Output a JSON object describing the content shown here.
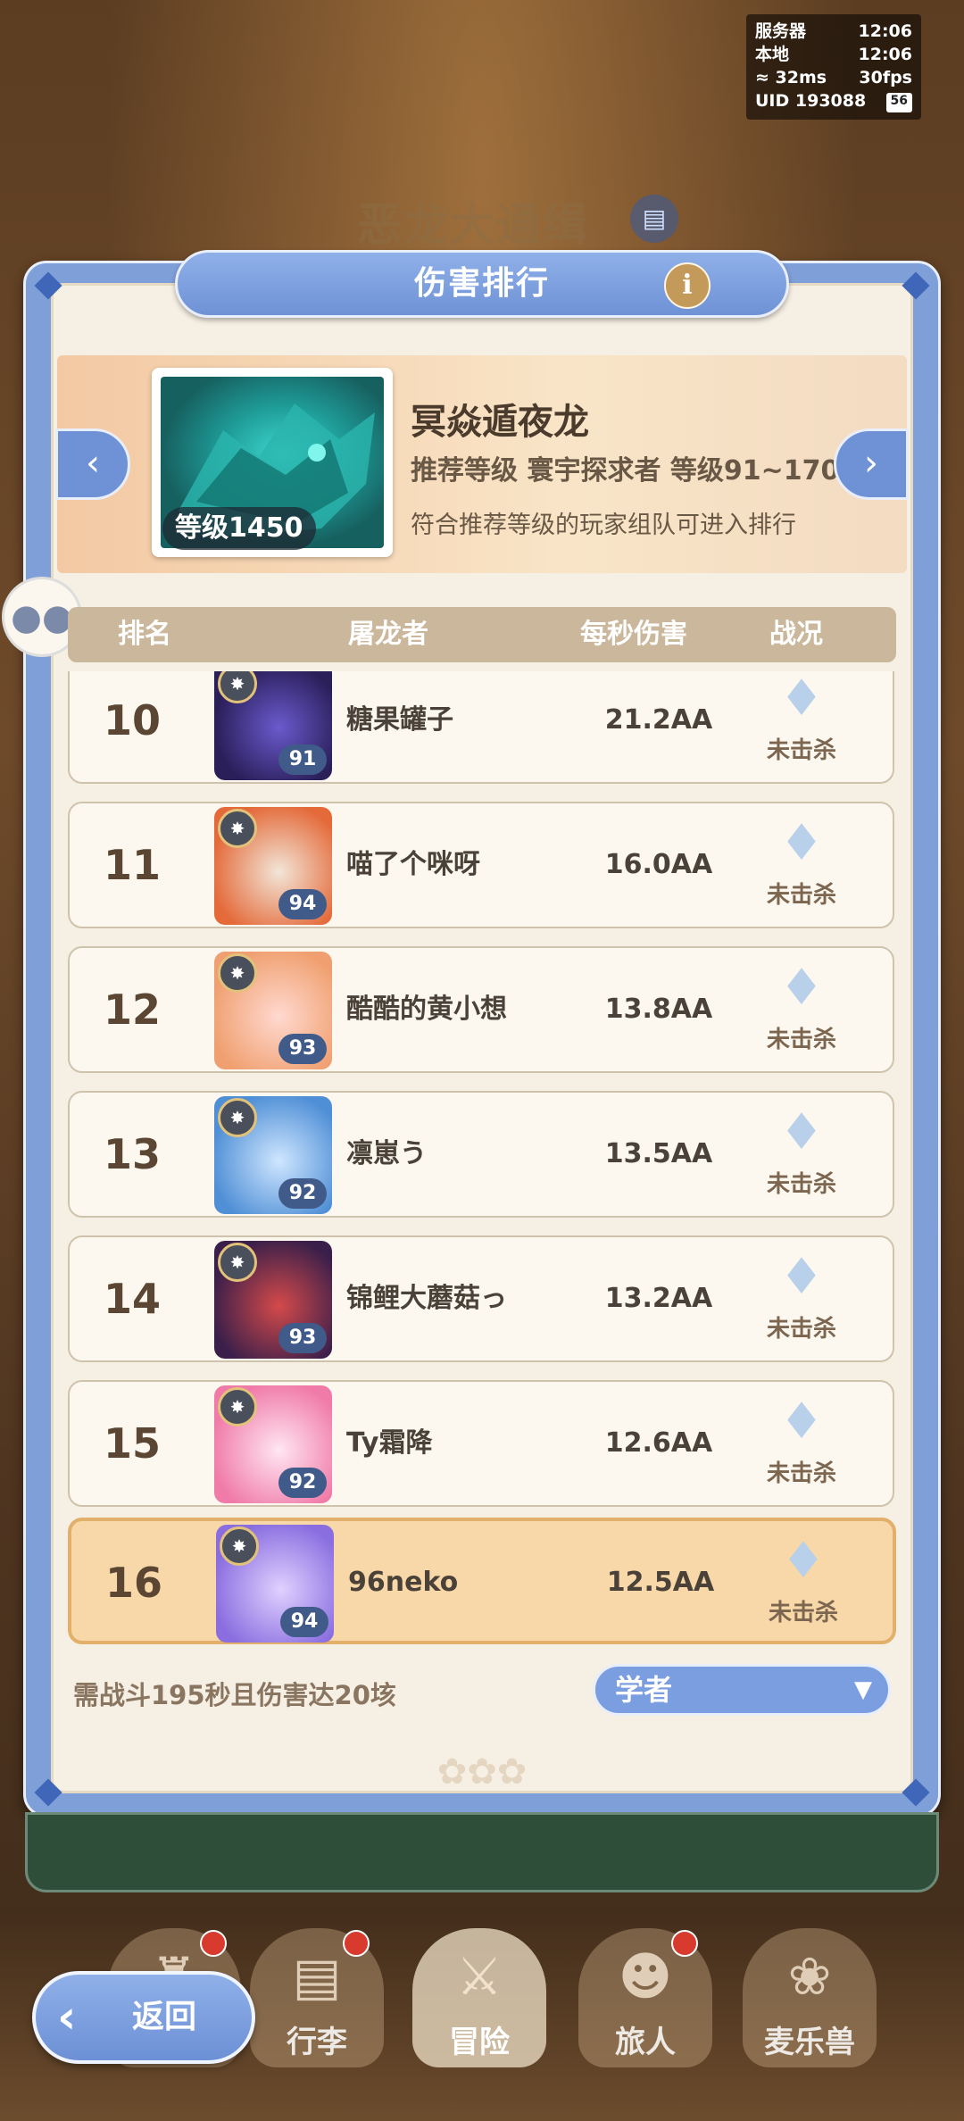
{
  "background": {
    "event_title": "恶龙大通缉",
    "book_icon": "book-icon"
  },
  "status_overlay": {
    "server_label": "服务器",
    "server_time": "12:06",
    "local_label": "本地",
    "local_time": "12:06",
    "ping": "32ms",
    "fps": "30fps",
    "uid": "UID 193088",
    "battery": "56"
  },
  "panel": {
    "title": "伤害排行",
    "info_icon": "i",
    "boss": {
      "name": "冥焱遁夜龙",
      "level_chip": "等级1450",
      "recommend": "推荐等级  寰宇探求者  等级91~170",
      "note": "符合推荐等级的玩家组队可进入排行"
    },
    "headers": {
      "rank": "排名",
      "slayer": "屠龙者",
      "dps": "每秒伤害",
      "status": "战况"
    },
    "rows": [
      {
        "rank": "10",
        "name": "糖果罐子",
        "level": "91",
        "dps": "21.2AA",
        "status": "未击杀"
      },
      {
        "rank": "11",
        "name": "喵了个咪呀",
        "level": "94",
        "dps": "16.0AA",
        "status": "未击杀"
      },
      {
        "rank": "12",
        "name": "酷酷的黄小想",
        "level": "93",
        "dps": "13.8AA",
        "status": "未击杀"
      },
      {
        "rank": "13",
        "name": "凛崽う",
        "level": "92",
        "dps": "13.5AA",
        "status": "未击杀"
      },
      {
        "rank": "14",
        "name": "锦鲤大蘑菇っ",
        "level": "93",
        "dps": "13.2AA",
        "status": "未击杀"
      },
      {
        "rank": "15",
        "name": "Ty霜降",
        "level": "92",
        "dps": "12.6AA",
        "status": "未击杀"
      }
    ],
    "self_row": {
      "rank": "16",
      "name": "96neko",
      "level": "94",
      "dps": "12.5AA",
      "status": "未击杀"
    },
    "requirement": "需战斗195秒且伤害达20垓",
    "class_select": {
      "selected": "学者"
    }
  },
  "nav": {
    "back": "返回",
    "items": [
      {
        "label": "行李",
        "icon": "chest-icon",
        "dot": true
      },
      {
        "label": "冒险",
        "icon": "crossed-swords-icon",
        "dot": false,
        "active": true
      },
      {
        "label": "旅人",
        "icon": "traveler-icon",
        "dot": true
      },
      {
        "label": "麦乐兽",
        "icon": "pet-icon",
        "dot": false
      }
    ]
  },
  "colors": {
    "panel_blue": "#7f9fd8",
    "self_highlight": "#f8d8a8",
    "alert_red": "#d83a2e"
  }
}
